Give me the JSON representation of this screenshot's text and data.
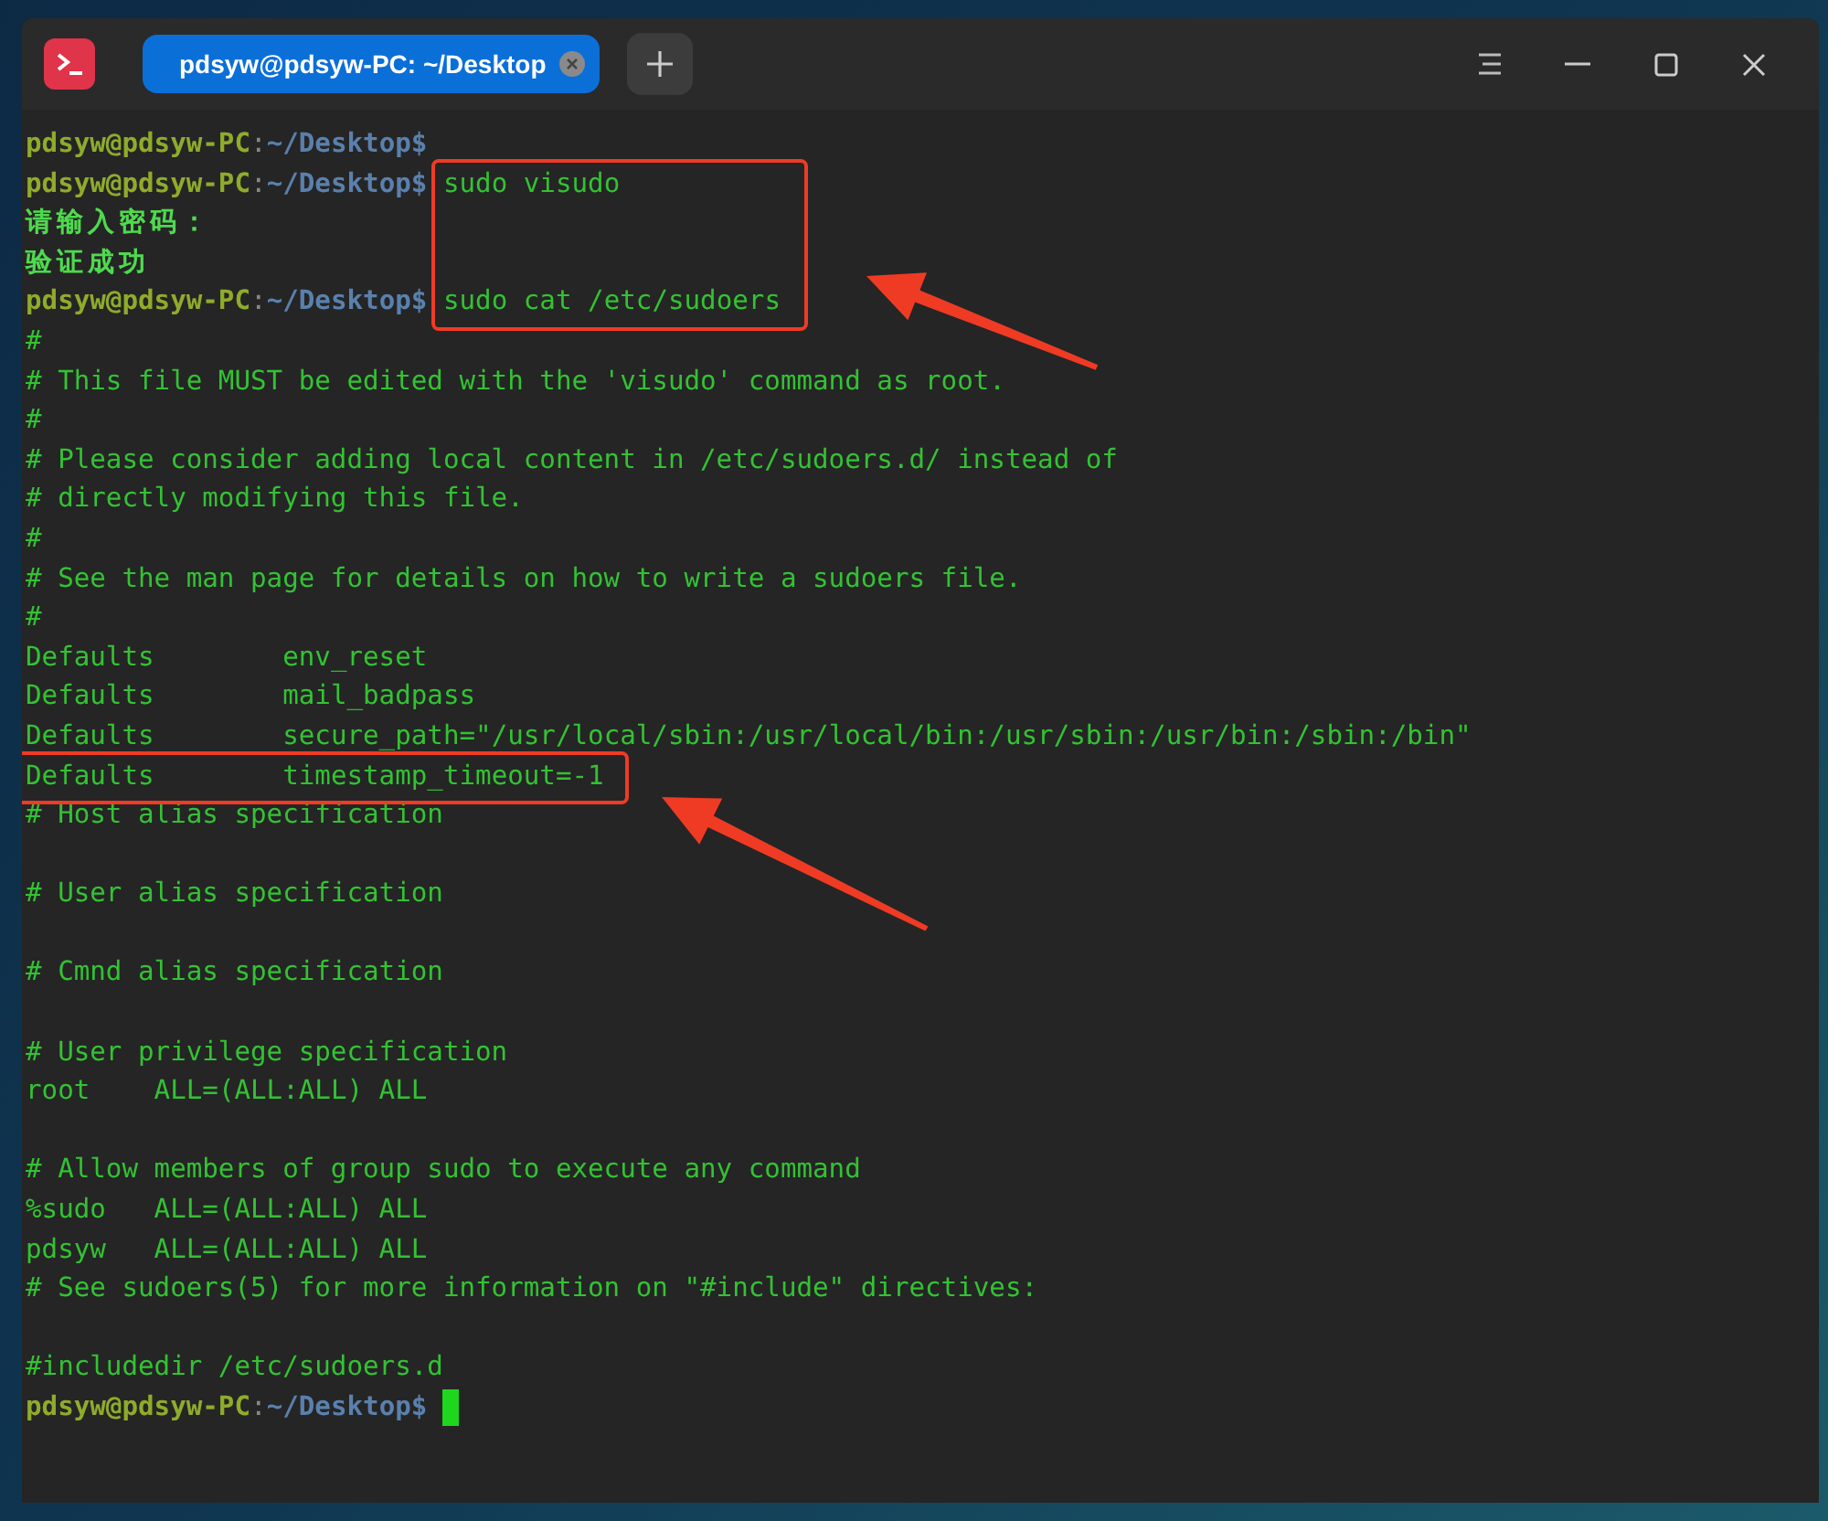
{
  "window": {
    "tabs": [
      {
        "title": "pdsyw@pdsyw-PC: ~/Desktop",
        "selected": true
      }
    ]
  },
  "terminal": {
    "lines": [
      {
        "kind": "prompt",
        "user_host": "pdsyw@pdsyw-PC",
        "separator": ":",
        "path": "~/Desktop$",
        "cursor": false,
        "highlighted": false
      },
      {
        "kind": "prompt",
        "user_host": "pdsyw@pdsyw-PC",
        "separator": ":",
        "path": "~/Desktop$",
        "command": "sudo visudo",
        "cursor": false,
        "highlighted": true
      },
      {
        "kind": "message",
        "text": "请输入密码：",
        "highlighted": false
      },
      {
        "kind": "message",
        "text": "验证成功",
        "highlighted": false
      },
      {
        "kind": "prompt",
        "user_host": "pdsyw@pdsyw-PC",
        "separator": ":",
        "path": "~/Desktop$",
        "command": "sudo cat /etc/sudoers",
        "cursor": false,
        "highlighted": true
      },
      {
        "kind": "text",
        "text": "#",
        "highlighted": false
      },
      {
        "kind": "text",
        "text": "# This file MUST be edited with the 'visudo' command as root.",
        "highlighted": false
      },
      {
        "kind": "text",
        "text": "#",
        "highlighted": false
      },
      {
        "kind": "text",
        "text": "# Please consider adding local content in /etc/sudoers.d/ instead of",
        "highlighted": false
      },
      {
        "kind": "text",
        "text": "# directly modifying this file.",
        "highlighted": false
      },
      {
        "kind": "text",
        "text": "#",
        "highlighted": false
      },
      {
        "kind": "text",
        "text": "# See the man page for details on how to write a sudoers file.",
        "highlighted": false
      },
      {
        "kind": "text",
        "text": "#",
        "highlighted": false
      },
      {
        "kind": "text",
        "text": "Defaults\tenv_reset",
        "highlighted": false
      },
      {
        "kind": "text",
        "text": "Defaults\tmail_badpass",
        "highlighted": false
      },
      {
        "kind": "text",
        "text": "Defaults\tsecure_path=\"/usr/local/sbin:/usr/local/bin:/usr/sbin:/usr/bin:/sbin:/bin\"",
        "highlighted": false
      },
      {
        "kind": "text",
        "text": "Defaults\ttimestamp_timeout=-1",
        "highlighted": true
      },
      {
        "kind": "text",
        "text": "# Host alias specification",
        "highlighted": false
      },
      {
        "kind": "blank"
      },
      {
        "kind": "text",
        "text": "# User alias specification",
        "highlighted": false
      },
      {
        "kind": "blank"
      },
      {
        "kind": "text",
        "text": "# Cmnd alias specification",
        "highlighted": false
      },
      {
        "kind": "blank"
      },
      {
        "kind": "text",
        "text": "# User privilege specification",
        "highlighted": false
      },
      {
        "kind": "text",
        "text": "root\tALL=(ALL:ALL) ALL",
        "highlighted": false
      },
      {
        "kind": "blank"
      },
      {
        "kind": "text",
        "text": "# Allow members of group sudo to execute any command",
        "highlighted": false
      },
      {
        "kind": "text",
        "text": "%sudo\tALL=(ALL:ALL) ALL",
        "highlighted": false
      },
      {
        "kind": "text",
        "text": "pdsyw\tALL=(ALL:ALL) ALL",
        "highlighted": false
      },
      {
        "kind": "text",
        "text": "# See sudoers(5) for more information on \"#include\" directives:",
        "highlighted": false
      },
      {
        "kind": "blank"
      },
      {
        "kind": "text",
        "text": "#includedir /etc/sudoers.d",
        "highlighted": false
      },
      {
        "kind": "prompt",
        "user_host": "pdsyw@pdsyw-PC",
        "separator": ":",
        "path": "~/Desktop$",
        "cursor": true,
        "highlighted": false
      }
    ]
  }
}
